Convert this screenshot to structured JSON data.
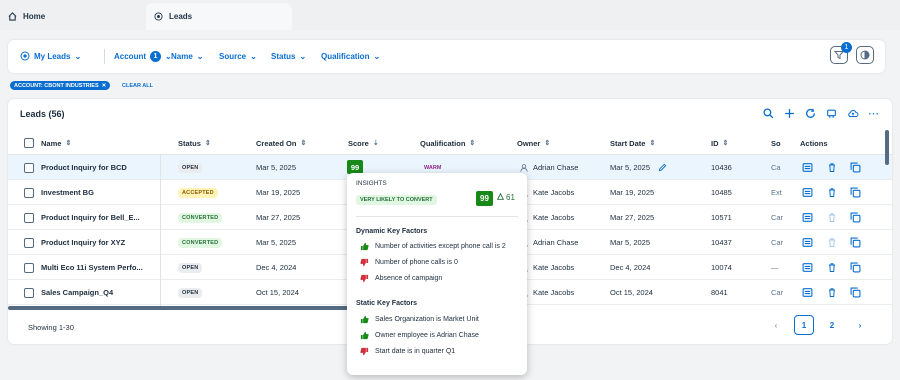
{
  "tabs": [
    {
      "label": "Home"
    },
    {
      "label": "Leads"
    }
  ],
  "filterbar": {
    "variant": "My Leads",
    "filters": [
      {
        "label": "Account",
        "badge": "1"
      },
      {
        "label": "Name"
      },
      {
        "label": "Source"
      },
      {
        "label": "Status"
      },
      {
        "label": "Qualification"
      }
    ],
    "filter_button_badge": "1"
  },
  "chips": {
    "active_filter": "ACCOUNT: CBONT INDUSTRIES",
    "clear_all": "CLEAR ALL"
  },
  "table": {
    "title": "Leads (56)",
    "columns": {
      "name": "Name",
      "status": "Status",
      "created": "Created On",
      "score": "Score",
      "qualification": "Qualification",
      "owner": "Owner",
      "start": "Start Date",
      "id": "ID",
      "source": "So",
      "actions": "Actions"
    },
    "rows": [
      {
        "name": "Product Inquiry for BCD",
        "status": "OPEN",
        "created": "Mar 5, 2025",
        "score": "99",
        "qualification": "WARM",
        "owner": "Adrian Chase",
        "start": "Mar 5, 2025",
        "id": "10436",
        "source": "Ca"
      },
      {
        "name": "Investment BG",
        "status": "ACCEPTED",
        "created": "Mar 19, 2025",
        "owner": "Kate Jacobs",
        "start": "Mar 19, 2025",
        "id": "10485",
        "source": "Ext"
      },
      {
        "name": "Product Inquiry for Bell_E...",
        "status": "CONVERTED",
        "created": "Mar 27, 2025",
        "owner": "Kate Jacobs",
        "start": "Mar 27, 2025",
        "id": "10571",
        "source": "Car"
      },
      {
        "name": "Product Inquiry for XYZ",
        "status": "CONVERTED",
        "created": "Mar 5, 2025",
        "owner": "Adrian Chase",
        "start": "Mar 5, 2025",
        "id": "10437",
        "source": "Car"
      },
      {
        "name": "Multi Eco 11i System Perfo...",
        "status": "OPEN",
        "created": "Dec 4, 2024",
        "owner": "Kate Jacobs",
        "start": "Dec 4, 2024",
        "id": "10074",
        "source": "—"
      },
      {
        "name": "Sales Campaign_Q4",
        "status": "OPEN",
        "created": "Oct 15, 2024",
        "owner": "Kate Jacobs",
        "start": "Oct 15, 2024",
        "id": "8041",
        "source": "Car"
      }
    ],
    "showing": "Showing 1-30",
    "pages": [
      "1",
      "2"
    ]
  },
  "insights": {
    "title": "INSIGHTS",
    "likelihood": "VERY LIKELY TO CONVERT",
    "score": "99",
    "delta": "61",
    "dynamic_title": "Dynamic Key Factors",
    "dynamic": [
      {
        "text": "Number of activities except phone call is 2",
        "sentiment": "positive"
      },
      {
        "text": "Number of phone calls is 0",
        "sentiment": "negative"
      },
      {
        "text": "Absence of campaign",
        "sentiment": "negative"
      }
    ],
    "static_title": "Static Key Factors",
    "static": [
      {
        "text": "Sales Organization is Market Unit",
        "sentiment": "positive"
      },
      {
        "text": "Owner employee is Adrian Chase",
        "sentiment": "positive"
      },
      {
        "text": "Start date is in quarter Q1",
        "sentiment": "negative"
      }
    ]
  },
  "colors": {
    "accent": "#0a6ed1",
    "positive": "#188918",
    "negative": "#d0303c"
  }
}
